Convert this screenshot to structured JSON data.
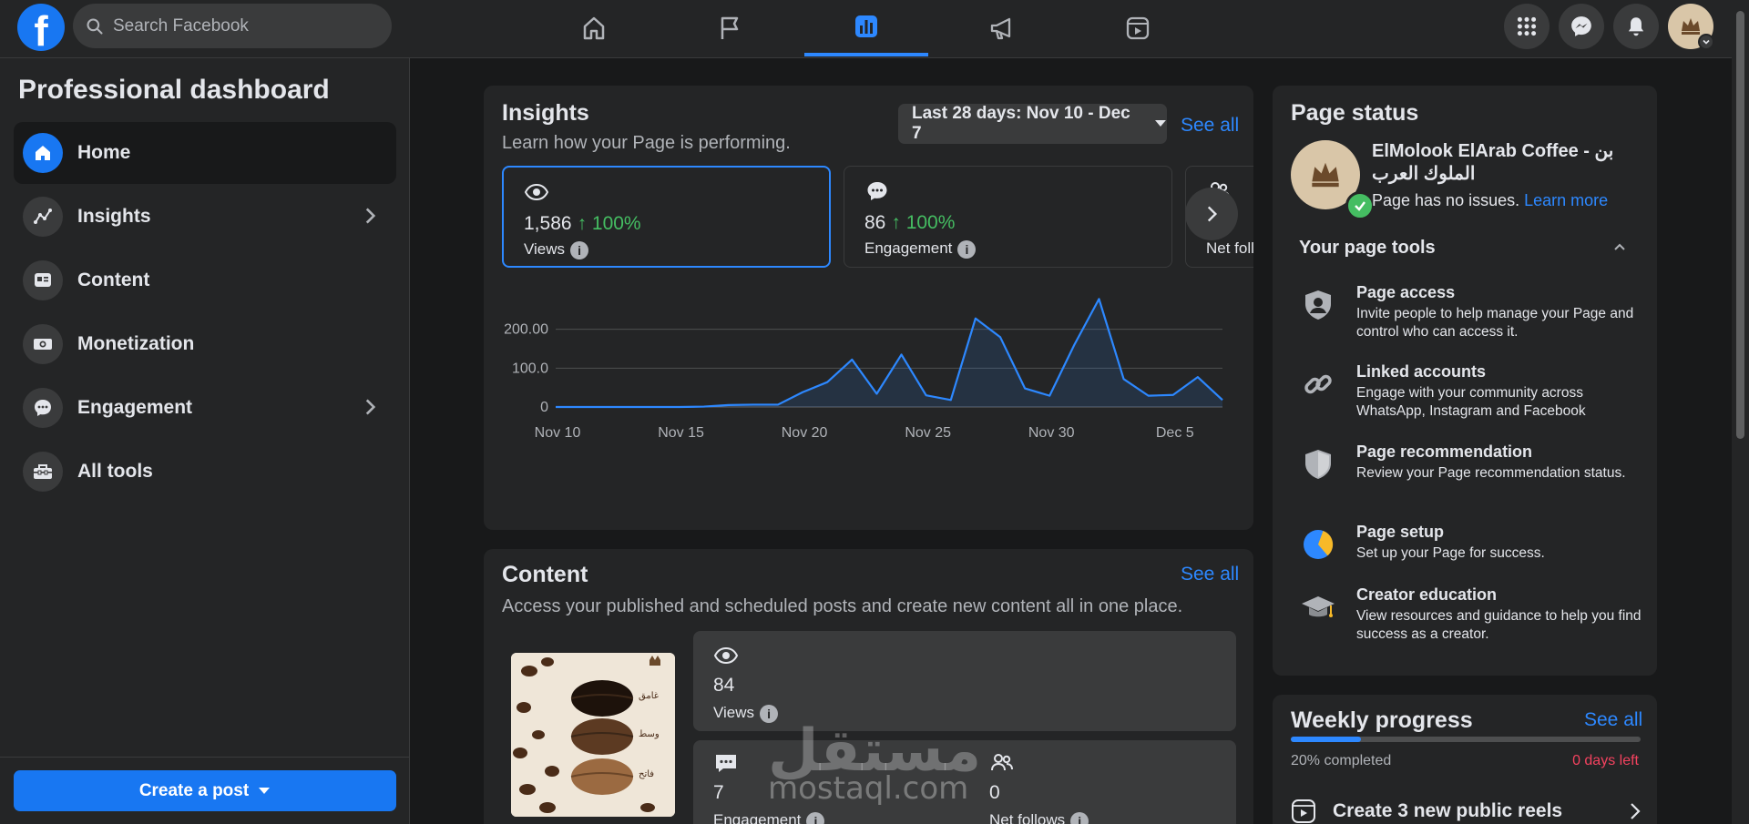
{
  "topbar": {
    "logo": "f",
    "search_placeholder": "Search Facebook",
    "nav_icons": [
      "home-icon",
      "flag-icon",
      "dashboard-icon",
      "megaphone-icon",
      "reels-icon"
    ],
    "active_tab": "dashboard-icon"
  },
  "sidebar": {
    "title": "Professional dashboard",
    "items": [
      {
        "label": "Home",
        "icon": "home-icon",
        "active": true
      },
      {
        "label": "Insights",
        "icon": "insights-icon",
        "chevron": true
      },
      {
        "label": "Content",
        "icon": "content-icon"
      },
      {
        "label": "Monetization",
        "icon": "money-icon"
      },
      {
        "label": "Engagement",
        "icon": "chat-icon",
        "chevron": true
      },
      {
        "label": "All tools",
        "icon": "toolbox-icon"
      }
    ],
    "create_post": "Create a post"
  },
  "insights": {
    "title": "Insights",
    "subtitle": "Learn how your Page is performing.",
    "date_range": "Last 28 days: Nov 10 - Dec 7",
    "see_all": "See all",
    "metrics": [
      {
        "value": "1,586",
        "change": "↑ 100%",
        "label": "Views"
      },
      {
        "value": "86",
        "change": "↑ 100%",
        "label": "Engagement"
      },
      {
        "value": "",
        "change": "↑",
        "label": "Net foll"
      }
    ]
  },
  "chart_data": {
    "type": "area",
    "x": [
      "Nov 10",
      "Nov 11",
      "Nov 12",
      "Nov 13",
      "Nov 14",
      "Nov 15",
      "Nov 16",
      "Nov 17",
      "Nov 18",
      "Nov 19",
      "Nov 20",
      "Nov 21",
      "Nov 22",
      "Nov 23",
      "Nov 24",
      "Nov 25",
      "Nov 26",
      "Nov 27",
      "Nov 28",
      "Nov 29",
      "Nov 30",
      "Dec 1",
      "Dec 2",
      "Dec 3",
      "Dec 4",
      "Dec 5",
      "Dec 6",
      "Dec 7"
    ],
    "values": [
      0,
      0,
      0,
      0,
      0,
      0,
      1,
      5,
      6,
      6,
      38,
      64,
      122,
      34,
      135,
      30,
      18,
      228,
      180,
      48,
      29,
      160,
      278,
      72,
      29,
      31,
      77,
      18
    ],
    "y_ticks": [
      "200.00",
      "100.0",
      "0"
    ],
    "x_ticks": [
      "Nov 10",
      "Nov 15",
      "Nov 20",
      "Nov 25",
      "Nov 30",
      "Dec 5"
    ],
    "ylim": [
      0,
      300
    ],
    "grid": true,
    "line_color": "#2d88ff"
  },
  "content": {
    "title": "Content",
    "see_all": "See all",
    "subtitle": "Access your published and scheduled posts and create new content all in one place.",
    "views_value": "84",
    "views_label": "Views",
    "engagement_value": "7",
    "engagement_label": "Engagement",
    "follows_value": "0",
    "follows_label": "Net follows",
    "thumb_labels": [
      "غامق",
      "وسط",
      "فاتح"
    ]
  },
  "page_status": {
    "title": "Page status",
    "page_name": "ElMolook ElArab Coffee - بن الملوك العرب",
    "status_text": "Page has no issues.",
    "learn_more": "Learn more",
    "tools_heading": "Your page tools",
    "tools": [
      {
        "title": "Page access",
        "desc": "Invite people to help manage your Page and control who can access it.",
        "icon": "shield-person-icon"
      },
      {
        "title": "Linked accounts",
        "desc": "Engage with your community across WhatsApp, Instagram and Facebook",
        "icon": "link-icon"
      },
      {
        "title": "Page recommendation",
        "desc": "Review your Page recommendation status.",
        "icon": "shield-icon"
      },
      {
        "title": "Page setup",
        "desc": "Set up your Page for success.",
        "icon": "progress-circle-icon"
      },
      {
        "title": "Creator education",
        "desc": "View resources and guidance to help you find success as a creator.",
        "icon": "graduation-cap-icon"
      }
    ]
  },
  "weekly": {
    "title": "Weekly progress",
    "see_all": "See all",
    "completed": "20% completed",
    "progress": 0.2,
    "days_left": "0 days left",
    "task": "Create 3 new public reels"
  },
  "watermark": {
    "arabic": "مستقل",
    "latin": "mostaql.com"
  }
}
